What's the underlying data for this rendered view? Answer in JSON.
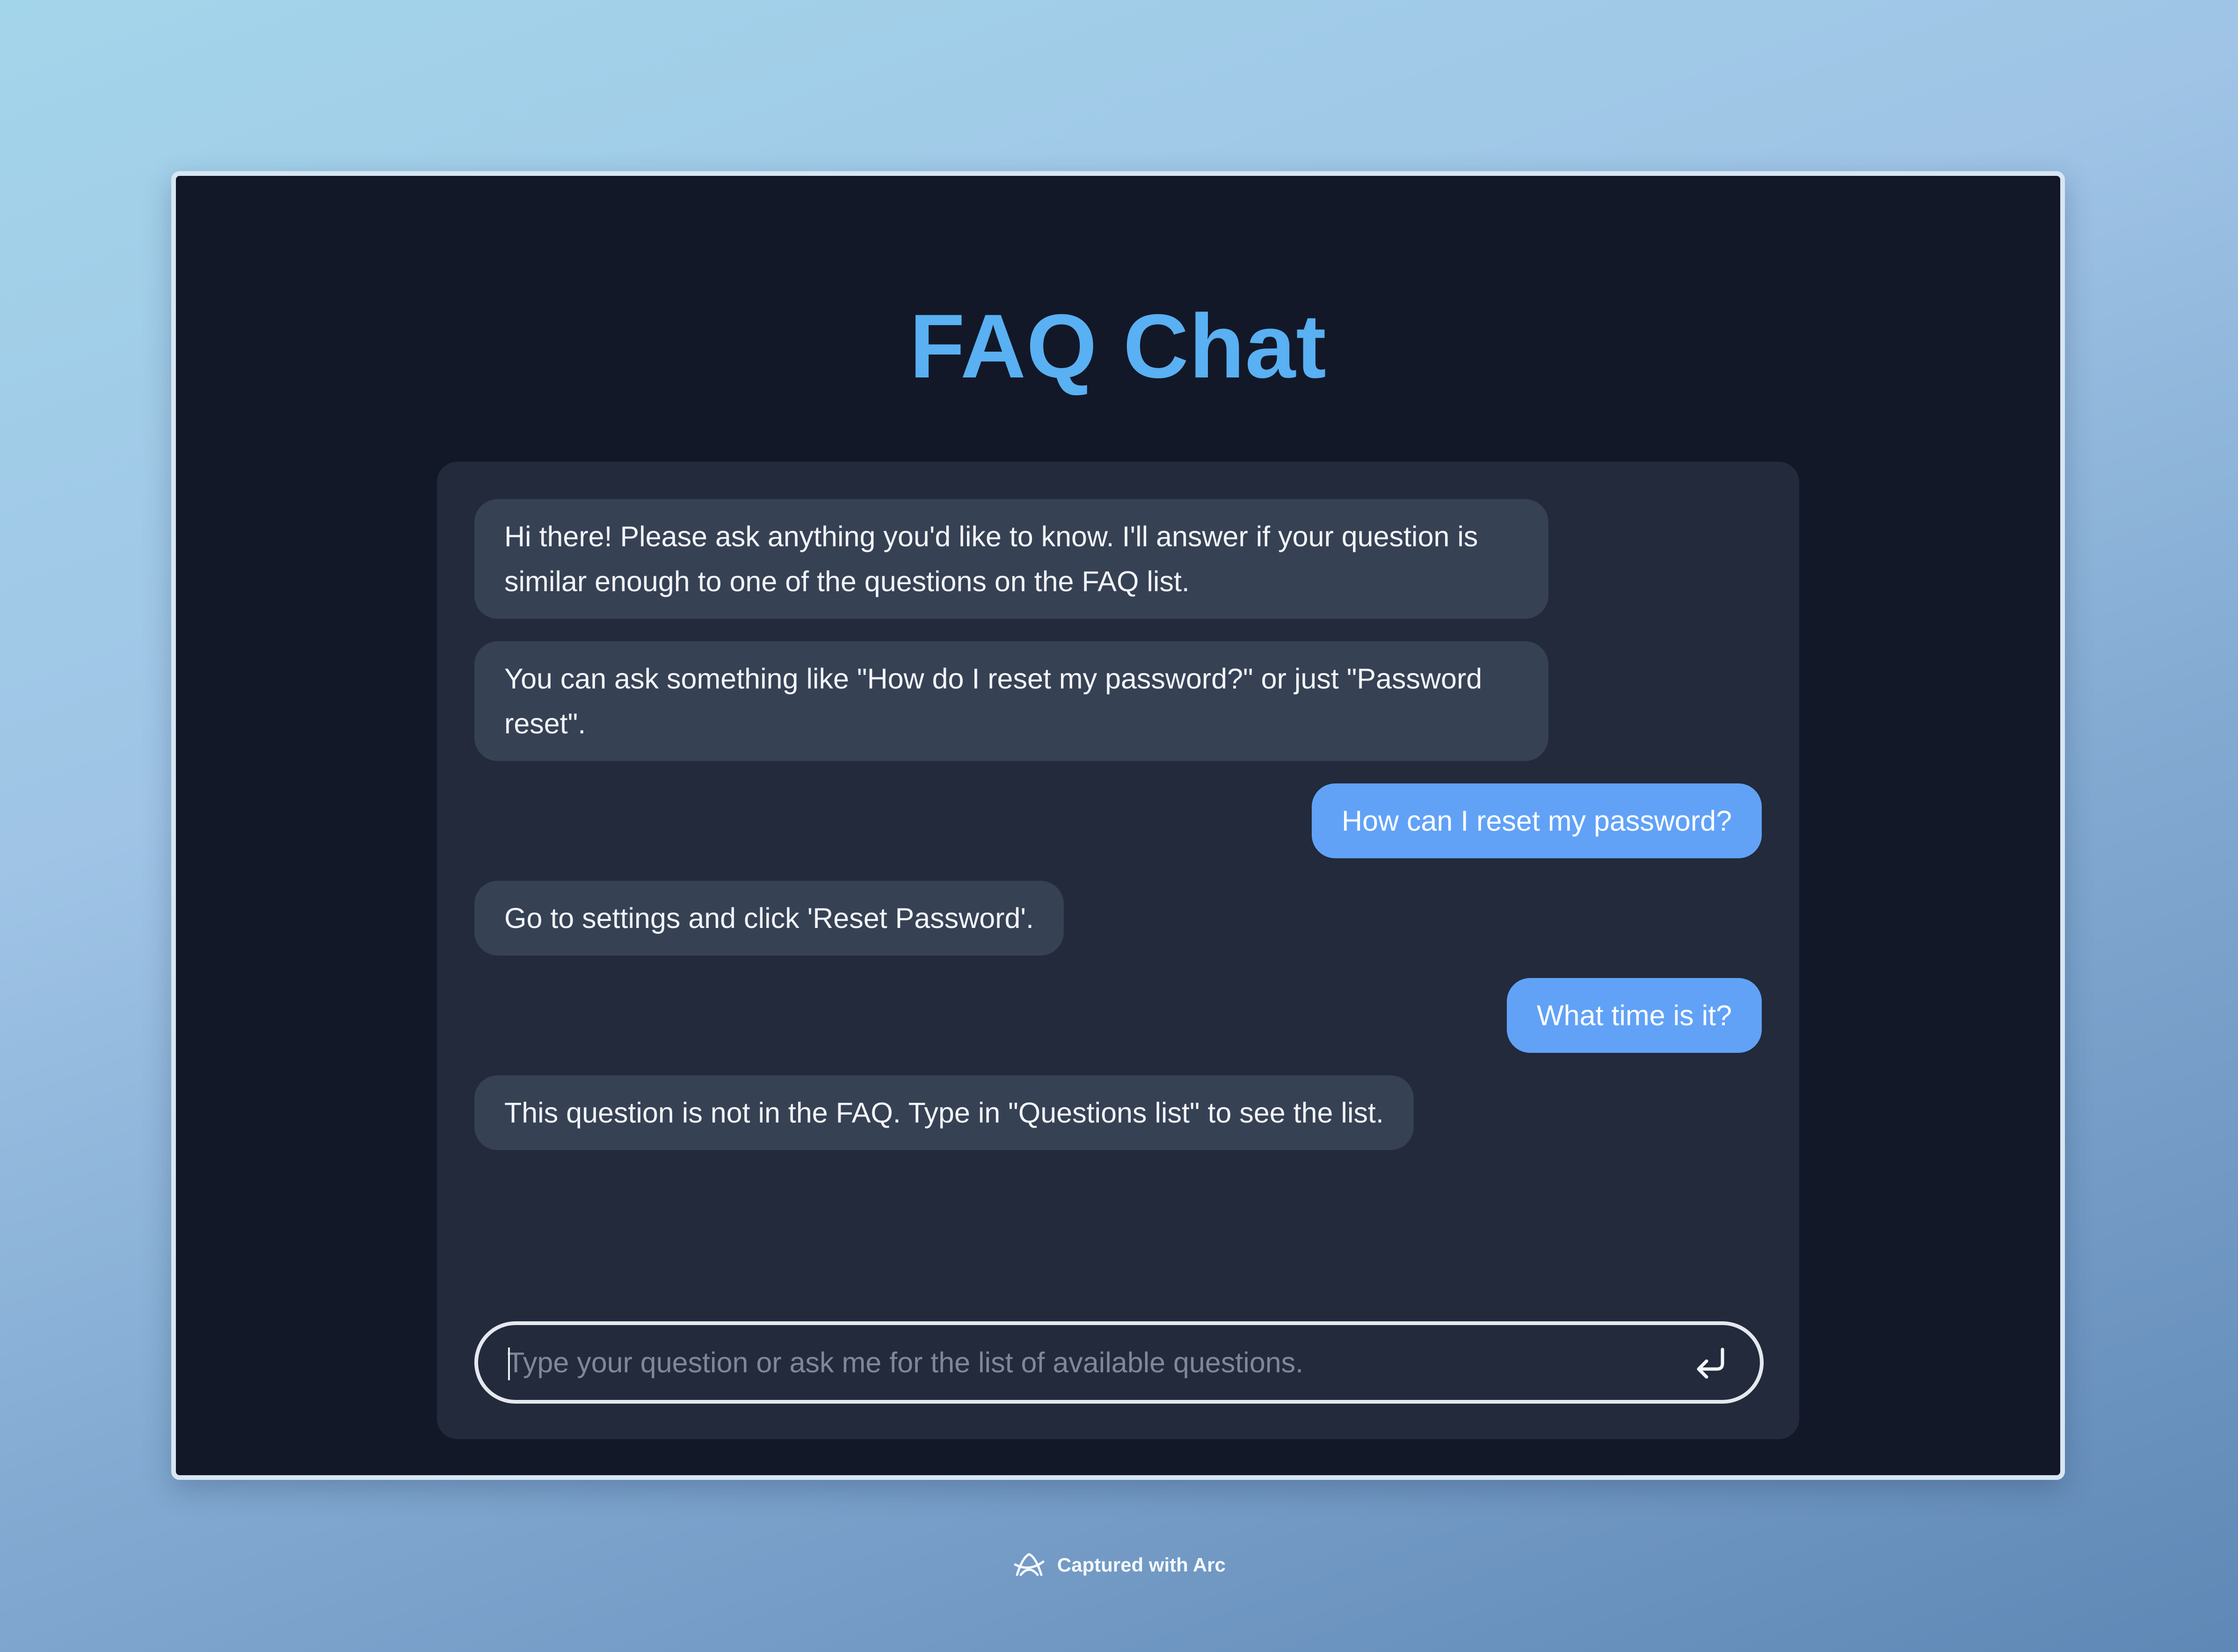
{
  "app": {
    "title": "FAQ Chat"
  },
  "messages": [
    {
      "role": "bot",
      "text": "Hi there! Please ask anything you'd like to know. I'll answer if your question is similar enough to one of the questions on the FAQ list."
    },
    {
      "role": "bot",
      "text": "You can ask something like \"How do I reset my password?\" or just \"Password reset\"."
    },
    {
      "role": "user",
      "text": "How can I reset my password?"
    },
    {
      "role": "bot",
      "text": "Go to settings and click 'Reset Password'."
    },
    {
      "role": "user",
      "text": "What time is it?"
    },
    {
      "role": "bot",
      "text": "This question is not in the FAQ. Type in \"Questions list\" to see the list."
    }
  ],
  "input": {
    "value": "",
    "placeholder": "Type your question or ask me for the list of available questions.",
    "send_icon": "enter-return-icon"
  },
  "footer": {
    "text": "Captured with Arc",
    "icon": "arc-logo-icon"
  },
  "colors": {
    "title": "#59b0f2",
    "window_bg": "#121828",
    "panel_bg": "#222a3b",
    "bot_bubble": "#374154",
    "user_bubble": "#61a2f7"
  }
}
